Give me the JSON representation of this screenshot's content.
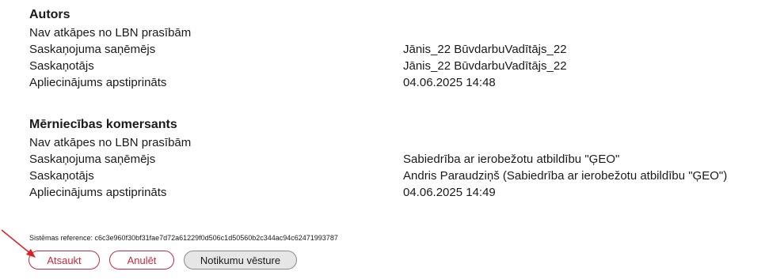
{
  "sections": [
    {
      "title": "Autors",
      "rows": [
        {
          "label": "Nav atkāpes no LBN prasībām",
          "value": ""
        },
        {
          "label": "Saskaņojuma saņēmējs",
          "value": "Jānis_22 BūvdarbuVadītājs_22"
        },
        {
          "label": "Saskaņotājs",
          "value": "Jānis_22 BūvdarbuVadītājs_22"
        },
        {
          "label": "Apliecinājums apstiprināts",
          "value": "04.06.2025 14:48"
        }
      ]
    },
    {
      "title": "Mērniecības komersants",
      "rows": [
        {
          "label": "Nav atkāpes no LBN prasībām",
          "value": ""
        },
        {
          "label": "Saskaņojuma saņēmējs",
          "value": "Sabiedrība ar ierobežotu atbildību \"ĢEO\""
        },
        {
          "label": "Saskaņotājs",
          "value": "Andris Paraudziņš (Sabiedrība ar ierobežotu atbildību \"ĢEO\")"
        },
        {
          "label": "Apliecinājums apstiprināts",
          "value": "04.06.2025 14:49"
        }
      ]
    }
  ],
  "system_reference": "Sistēmas reference: c6c3e960f30bf31fae7d72a61229f0d506c1d50560b2c344ac94c62471993787",
  "buttons": {
    "recall": "Atsaukt",
    "cancel": "Anulēt",
    "history": "Notikumu vēsture"
  },
  "colors": {
    "accent_red": "#c5283d",
    "annotation_arrow": "#e02020"
  }
}
